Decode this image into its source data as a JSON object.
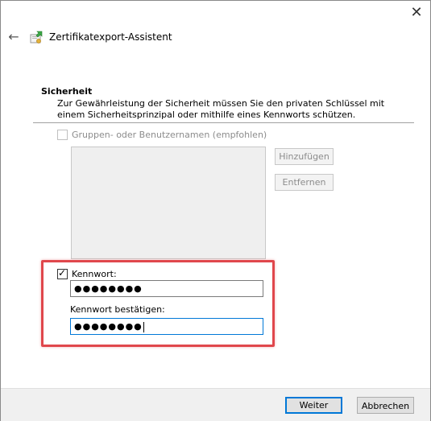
{
  "window": {
    "title": "Zertifikatexport-Assistent",
    "close_glyph": "✕",
    "back_glyph": "←",
    "icon": "certificate-wizard-icon"
  },
  "section": {
    "heading": "Sicherheit",
    "description": "Zur Gewährleistung der Sicherheit müssen Sie den privaten Schlüssel mit einem Sicherheitsprinzipal oder mithilfe eines Kennworts schützen."
  },
  "groups": {
    "checkbox_label": "Gruppen- oder Benutzernamen (empfohlen)",
    "checked": false,
    "enabled": false,
    "add_button": "Hinzufügen",
    "remove_button": "Entfernen"
  },
  "password": {
    "checkbox_label": "Kennwort:",
    "checked": true,
    "value_masked": "●●●●●●●●",
    "confirm_label": "Kennwort bestätigen:",
    "confirm_value_masked": "●●●●●●●●"
  },
  "footer": {
    "next_button": "Weiter",
    "cancel_button": "Abbrechen"
  },
  "colors": {
    "highlight": "#e0474c",
    "focus": "#0078d7"
  }
}
